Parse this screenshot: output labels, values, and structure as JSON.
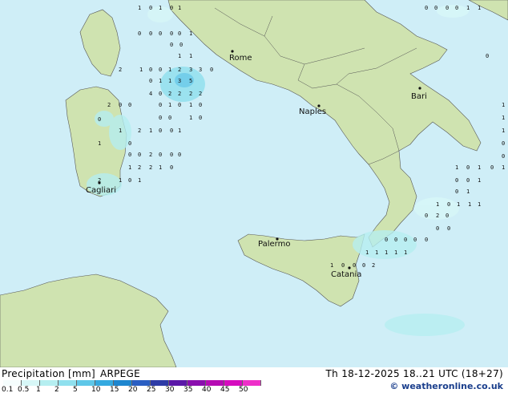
{
  "map": {
    "cities": [
      {
        "name": "Rome"
      },
      {
        "name": "Naples"
      },
      {
        "name": "Bari"
      },
      {
        "name": "Cagliari"
      },
      {
        "name": "Palermo"
      },
      {
        "name": "Catania"
      }
    ],
    "precip_values": [
      "1",
      "0",
      "1",
      "0",
      "1",
      "0",
      "0",
      "0",
      "0",
      "0",
      "1",
      "0",
      "0",
      "1",
      "1",
      "2",
      "1",
      "0",
      "0",
      "1",
      "2",
      "3",
      "3",
      "0",
      "0",
      "1",
      "1",
      "3",
      "5",
      "4",
      "0",
      "2",
      "2",
      "2",
      "2",
      "2",
      "0",
      "0",
      "0",
      "1",
      "0",
      "1",
      "0",
      "0",
      "0",
      "1",
      "0",
      "0",
      "1",
      "2",
      "1",
      "0",
      "0",
      "1",
      "1",
      "0",
      "0",
      "0",
      "2",
      "0",
      "0",
      "0",
      "1",
      "2",
      "2",
      "1",
      "0",
      "2",
      "1",
      "0",
      "1",
      "0",
      "1",
      "1",
      "0",
      "0",
      "0",
      "0",
      "1",
      "1",
      "1",
      "0",
      "0",
      "1",
      "1",
      "0",
      "1",
      "0",
      "0",
      "0",
      "1",
      "0",
      "1",
      "1",
      "0",
      "1",
      "1",
      "1",
      "0",
      "2",
      "0",
      "0",
      "0",
      "0",
      "0",
      "0",
      "0",
      "0",
      "1",
      "1",
      "1",
      "1",
      "1",
      "1",
      "0",
      "0",
      "0",
      "2",
      "1",
      "2",
      "1",
      "1",
      "0",
      "1",
      "1"
    ]
  },
  "footer": {
    "title": "Precipitation [mm]",
    "model": "ARPEGE",
    "datetime": "Th 18-12-2025 18..21 UTC (18+27)",
    "credit": "© weatheronline.co.uk",
    "scale_labels": [
      "0.1",
      "0.5",
      "1",
      "2",
      "5",
      "10",
      "15",
      "20",
      "25",
      "30",
      "35",
      "40",
      "45",
      "50"
    ],
    "scale_colors": [
      "#f5fdfd",
      "#d7f7f7",
      "#b5eef0",
      "#8fe0ee",
      "#5ec7e8",
      "#34a9e0",
      "#1e86cf",
      "#2a5ec2",
      "#2d3ba6",
      "#5b18a8",
      "#8a0fae",
      "#b60cb4",
      "#d60cbf",
      "#ee2fc9"
    ]
  }
}
